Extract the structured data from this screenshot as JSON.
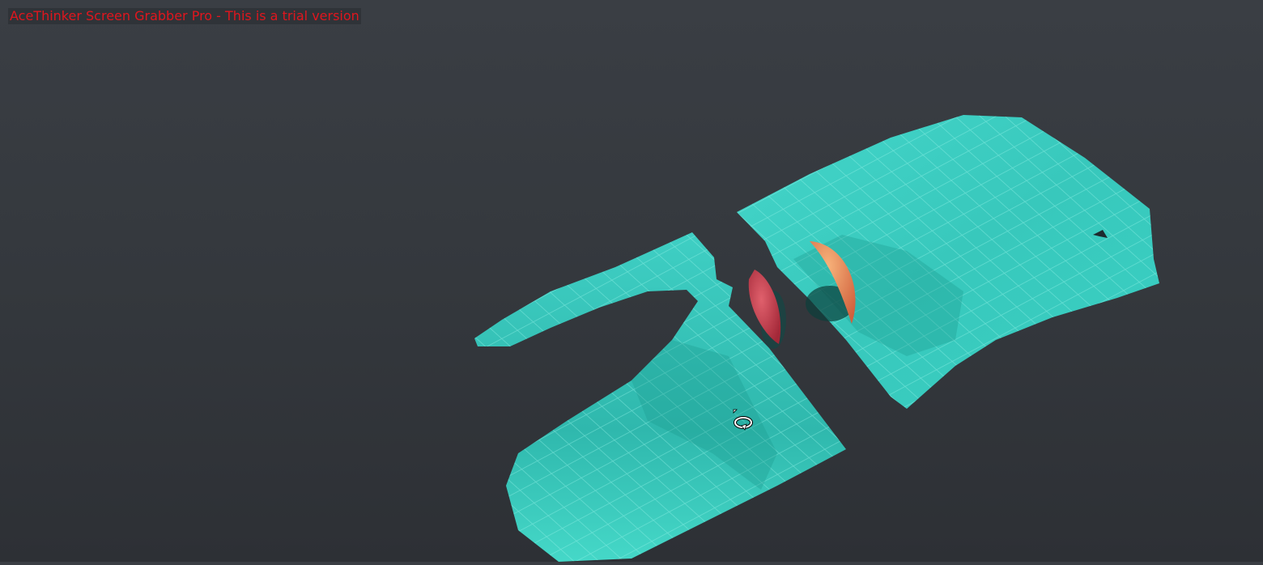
{
  "watermark": {
    "text": "AceThinker Screen Grabber Pro - This is a trial version"
  },
  "viewport": {
    "cursor": "rotate-cursor-icon"
  },
  "colors": {
    "background": "#36393e",
    "mesh": "#3ed3c6",
    "grid": "#8ff0e6",
    "watermark": "#e0161e",
    "apple_red": "#c23a4a",
    "apple_orange": "#e8885a"
  }
}
